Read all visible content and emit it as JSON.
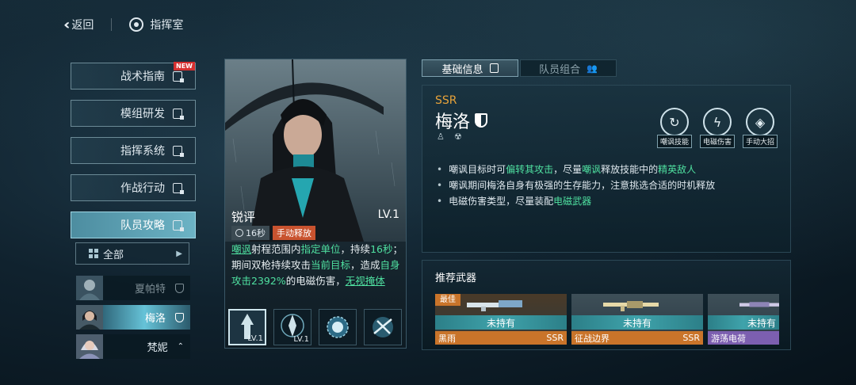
{
  "topbar": {
    "back_label": "返回",
    "breadcrumb": "指挥室"
  },
  "nav": {
    "items": [
      {
        "label": "战术指南",
        "badge": "NEW"
      },
      {
        "label": "模组研发"
      },
      {
        "label": "指挥系统"
      },
      {
        "label": "作战行动"
      },
      {
        "label": "队员攻略",
        "active": true
      }
    ]
  },
  "filter": {
    "label": "全部"
  },
  "characters": [
    {
      "name": "夏帕特"
    },
    {
      "name": "梅洛"
    },
    {
      "name": "梵妮"
    }
  ],
  "skill": {
    "name": "锐评",
    "level": "LV.1",
    "cooldown": "16秒",
    "type": "手动释放",
    "desc": {
      "p1": "嘲讽",
      "p2": "射程范围内",
      "p3": "指定单位",
      "p4": "，持续",
      "p5": "16秒",
      "p6": "；期间双枪持续攻击",
      "p7": "当前目标",
      "p8": "，造成",
      "p9": "自身攻击2392%",
      "p10": "的电磁伤害，",
      "p11": "无视掩体"
    },
    "slots": [
      {
        "level": "LV.1"
      },
      {
        "level": "LV.1"
      },
      {
        "level": ""
      },
      {
        "level": ""
      }
    ]
  },
  "tabs": {
    "basic": "基础信息",
    "team": "队员组合"
  },
  "info": {
    "rarity": "SSR",
    "name": "梅洛",
    "features": [
      "嘲讽技能",
      "电磁伤害",
      "手动大招"
    ],
    "lines": [
      {
        "a": "嘲讽目标时可",
        "b": "偏转其攻击",
        "c": "，尽量",
        "d": "嘲讽",
        "e": "释放技能中的",
        "f": "精英敌人"
      },
      {
        "a": "嘲讽期间梅洛自身有极强的生存能力，注意挑选合适的时机释放"
      },
      {
        "a": "电磁伤害类型，尽量装配",
        "b": "电磁武器"
      }
    ]
  },
  "weapons": {
    "title": "推荐武器",
    "best_label": "最佳",
    "items": [
      {
        "name": "黑雨",
        "rarity": "SSR",
        "status": "未持有"
      },
      {
        "name": "征战边界",
        "rarity": "SSR",
        "status": "未持有"
      },
      {
        "name": "游荡电荷",
        "rarity": "",
        "status": "未持有"
      }
    ]
  },
  "colors": {
    "accent": "#4fe0a0",
    "ssr": "#e8a33a",
    "manual": "#c9532f",
    "active_nav": "#6cb3c5"
  }
}
